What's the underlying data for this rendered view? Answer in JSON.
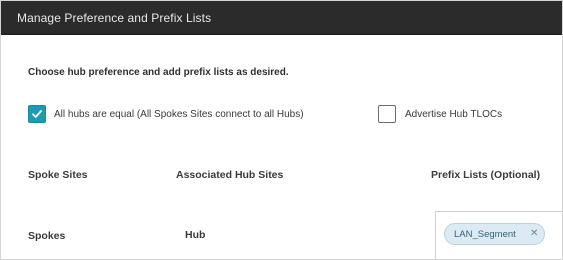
{
  "dialog": {
    "title": "Manage Preference and Prefix Lists",
    "instruction": "Choose hub preference and add prefix lists as desired."
  },
  "options": {
    "all_hubs_equal": {
      "label": "All hubs are equal (All Spokes Sites connect to all Hubs)",
      "checked": true
    },
    "advertise_hub_tlocs": {
      "label": "Advertise Hub TLOCs",
      "checked": false
    }
  },
  "table": {
    "headers": [
      "Spoke Sites",
      "Associated Hub Sites",
      "Prefix Lists (Optional)"
    ],
    "rows": [
      {
        "spoke": "Spokes",
        "hub": "Hub",
        "prefix_lists": [
          "LAN_Segment"
        ]
      }
    ]
  },
  "colors": {
    "title_bar": "#2b2b2b",
    "checkbox_accent": "#1e9bb0",
    "chip_bg": "#dcebf3"
  },
  "icons": {
    "checkbox_checked": "check-icon",
    "chip_remove": "close-icon"
  }
}
